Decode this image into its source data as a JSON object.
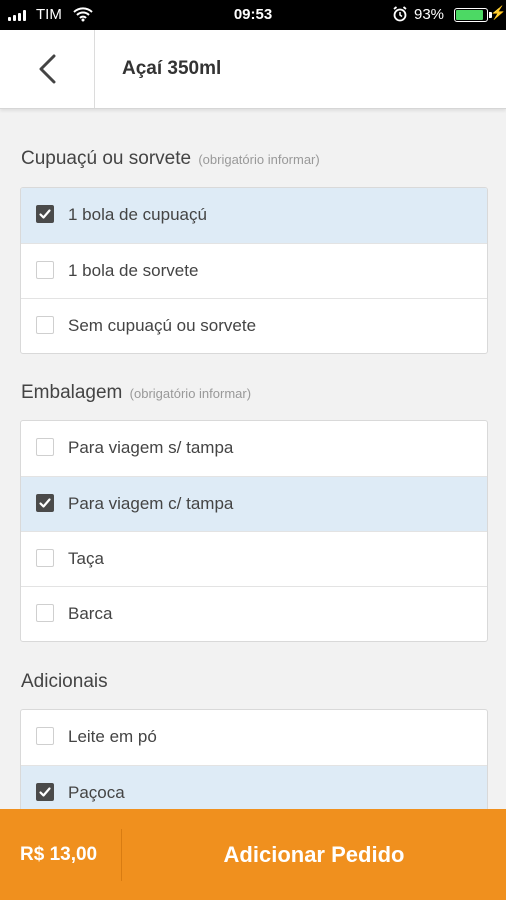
{
  "status_bar": {
    "carrier": "TIM",
    "time": "09:53",
    "battery": "93%",
    "battery_level": 0.93
  },
  "header": {
    "title": "Açaí 350ml"
  },
  "sections": [
    {
      "title": "Cupuaçú ou sorvete",
      "hint": "(obrigatório informar)",
      "options": [
        {
          "label": "1 bola de cupuaçú",
          "checked": true
        },
        {
          "label": "1 bola de sorvete",
          "checked": false
        },
        {
          "label": "Sem cupuaçú ou sorvete",
          "checked": false
        }
      ]
    },
    {
      "title": "Embalagem",
      "hint": "(obrigatório informar)",
      "options": [
        {
          "label": "Para viagem s/ tampa",
          "checked": false
        },
        {
          "label": "Para viagem c/ tampa",
          "checked": true
        },
        {
          "label": "Taça",
          "checked": false
        },
        {
          "label": "Barca",
          "checked": false
        }
      ]
    },
    {
      "title": "Adicionais",
      "hint": "",
      "options": [
        {
          "label": "Leite em pó",
          "checked": false
        },
        {
          "label": "Paçoca",
          "checked": true
        }
      ]
    }
  ],
  "footer": {
    "price": "R$ 13,00",
    "action_label": "Adicionar Pedido"
  },
  "colors": {
    "accent": "#f0901e",
    "selected_row": "#deebf6"
  }
}
